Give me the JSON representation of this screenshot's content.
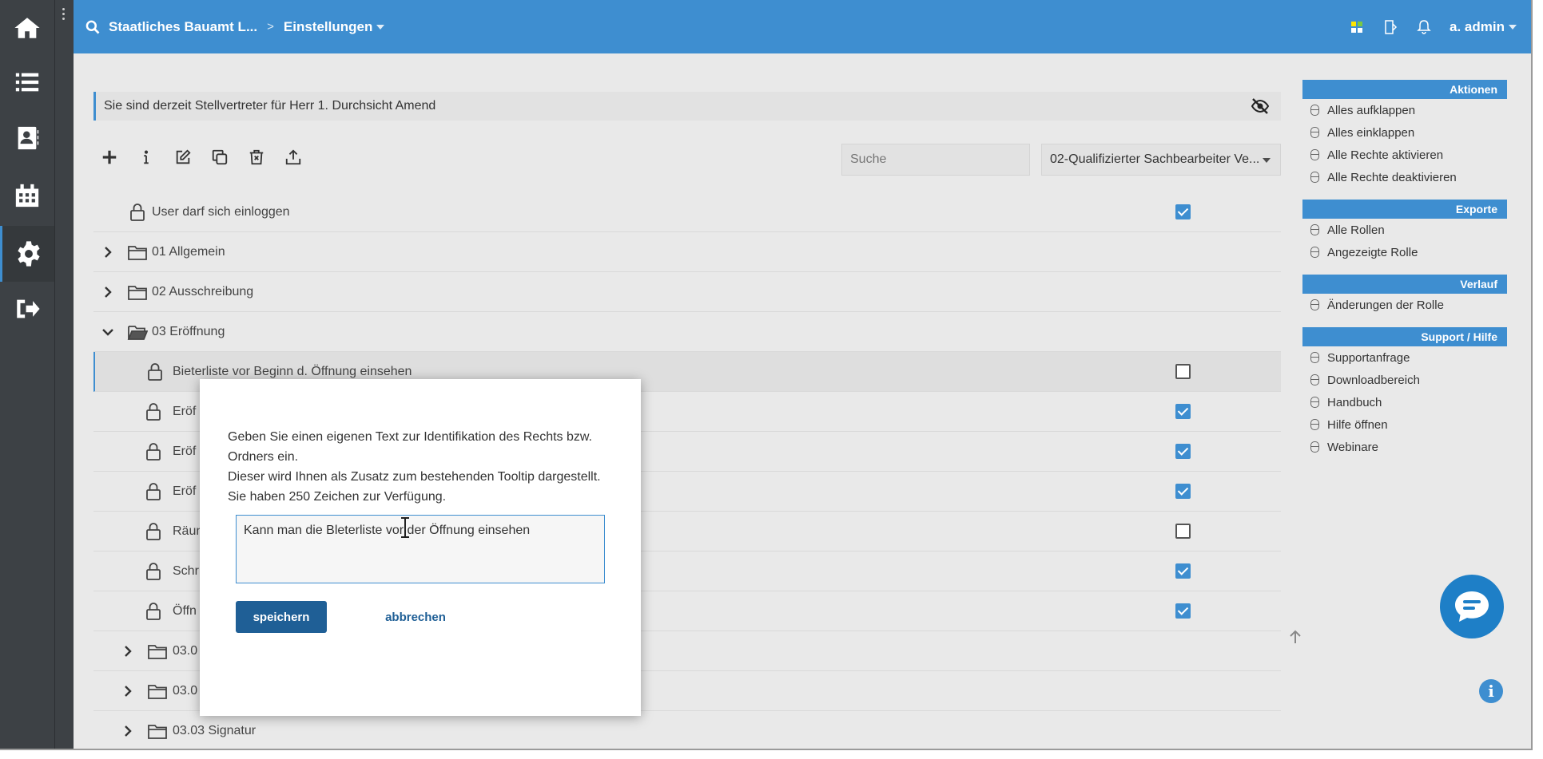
{
  "topbar": {
    "breadcrumb_org": "Staatliches Bauamt L...",
    "breadcrumb_page": "Einstellungen",
    "user": "a. admin"
  },
  "sidebar": {
    "items": [
      "home-icon",
      "list-icon",
      "contacts-icon",
      "calendar-icon",
      "settings-icon",
      "logout-icon"
    ]
  },
  "main": {
    "deputy_notice": "Sie sind derzeit Stellvertreter für Herr 1. Durchsicht Amend",
    "search_placeholder": "Suche",
    "role_selected": "02-Qualifizierter Sachbearbeiter Ve...",
    "tree": [
      {
        "label": "User darf sich einloggen",
        "type": "right",
        "checked": true
      },
      {
        "label": "01 Allgemein",
        "type": "folder"
      },
      {
        "label": "02 Ausschreibung",
        "type": "folder"
      },
      {
        "label": "03 Eröffnung",
        "type": "folder-open"
      },
      {
        "label": "Bieterliste vor Beginn d. Öffnung einsehen",
        "type": "right",
        "checked": false
      },
      {
        "label": "Eröf",
        "type": "right",
        "checked": true
      },
      {
        "label": "Eröf",
        "type": "right",
        "checked": true
      },
      {
        "label": "Eröf",
        "type": "right",
        "checked": true
      },
      {
        "label": "Räun",
        "type": "right",
        "checked": false
      },
      {
        "label": "Schr",
        "type": "right",
        "checked": true
      },
      {
        "label": "Öffn",
        "type": "right",
        "checked": true
      },
      {
        "label": "03.0",
        "type": "folder"
      },
      {
        "label": "03.0",
        "type": "folder"
      },
      {
        "label": "03.03 Signatur",
        "type": "folder"
      }
    ]
  },
  "right_panel": {
    "aktionen": {
      "title": "Aktionen",
      "items": [
        "Alles aufklappen",
        "Alles einklappen",
        "Alle Rechte aktivieren",
        "Alle Rechte deaktivieren"
      ]
    },
    "exporte": {
      "title": "Exporte",
      "items": [
        "Alle Rollen",
        "Angezeigte Rolle"
      ]
    },
    "verlauf": {
      "title": "Verlauf",
      "items": [
        "Änderungen der Rolle"
      ]
    },
    "support": {
      "title": "Support / Hilfe",
      "items": [
        "Supportanfrage",
        "Downloadbereich",
        "Handbuch",
        "Hilfe öffnen",
        "Webinare"
      ]
    }
  },
  "modal": {
    "line1": "Geben Sie einen eigenen Text zur Identifikation des Rechts bzw.",
    "line2": "Ordners ein.",
    "line3": "Dieser wird Ihnen als Zusatz zum bestehenden Tooltip dargestellt.",
    "line4": "Sie haben 250 Zeichen zur Verfügung.",
    "textarea_value": "Kann man die Bleterliste vor der Öffnung einsehen",
    "save_label": "speichern",
    "cancel_label": "abbrechen"
  },
  "colors": {
    "accent": "#3e8ed0",
    "sidebar": "#3d4145",
    "button": "#1f5f96"
  }
}
